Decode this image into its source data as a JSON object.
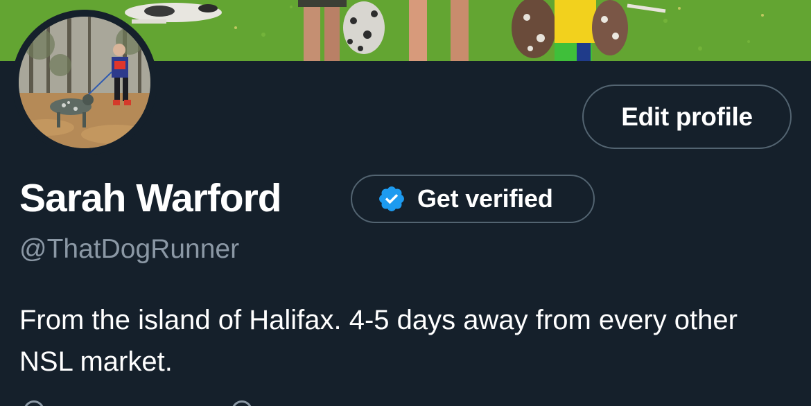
{
  "profile": {
    "display_name": "Sarah Warford",
    "handle": "@ThatDogRunner",
    "bio": "From the island of Halifax. 4-5 days away from every other NSL market."
  },
  "buttons": {
    "edit_profile": "Edit profile",
    "get_verified": "Get verified"
  },
  "icons": {
    "verified_badge": "verified-badge-icon",
    "meta_left": "location-icon",
    "meta_right": "calendar-icon"
  },
  "colors": {
    "background": "#15202b",
    "border": "#536471",
    "secondary_text": "#8b98a5",
    "verified_blue": "#1d9bf0"
  }
}
